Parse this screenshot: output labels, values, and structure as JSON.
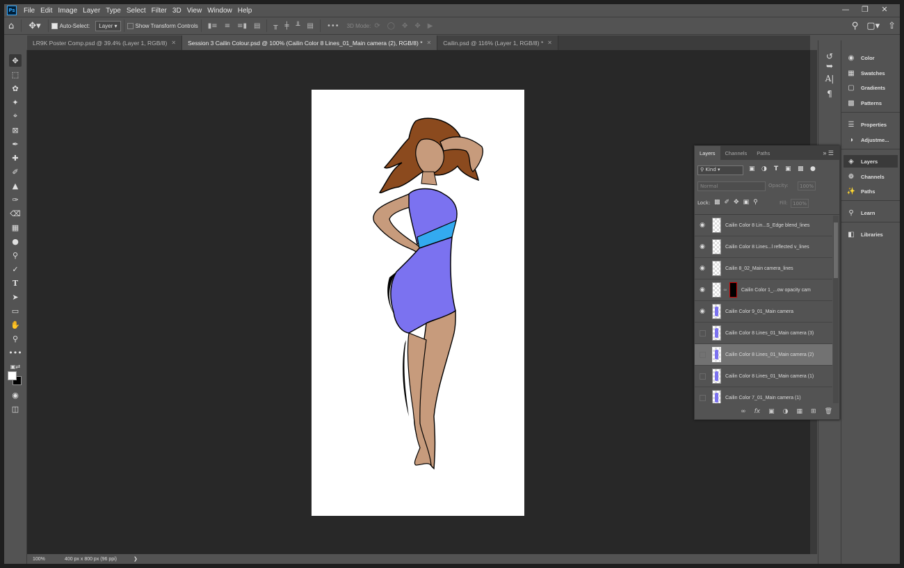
{
  "menubar": {
    "app_icon": "Ps",
    "items": [
      "File",
      "Edit",
      "Image",
      "Layer",
      "Type",
      "Select",
      "Filter",
      "3D",
      "View",
      "Window",
      "Help"
    ]
  },
  "options_bar": {
    "auto_select_label": "Auto-Select:",
    "auto_select_value": "Layer",
    "show_transform_label": "Show Transform Controls",
    "three_d_label": "3D Mode:",
    "auto_select_checked": true,
    "show_transform_checked": false
  },
  "tabs": [
    {
      "label": "LR9K Poster Comp.psd @ 39.4% (Layer 1, RGB/8)",
      "active": false
    },
    {
      "label": "Session 3 Cailin Colour.psd @ 100% (Cailin Color 8 Lines_01_Main camera (2), RGB/8) *",
      "active": true
    },
    {
      "label": "Cailin.psd @ 116% (Layer 1, RGB/8) *",
      "active": false
    }
  ],
  "status": {
    "zoom": "100%",
    "doc_info": "400 px x 800 px (96 ppi)"
  },
  "dock": {
    "items": [
      "Color",
      "Swatches",
      "Gradients",
      "Patterns",
      "Properties",
      "Adjustme...",
      "Layers",
      "Channels",
      "Paths",
      "Learn",
      "Libraries"
    ]
  },
  "layers_panel": {
    "tabs": [
      "Layers",
      "Channels",
      "Paths"
    ],
    "filter_label": "Kind",
    "blend_mode": "Normal",
    "opacity_label": "Opacity:",
    "opacity_value": "100%",
    "lock_label": "Lock:",
    "fill_label": "Fill:",
    "fill_value": "100%",
    "layers": [
      {
        "name": "Cailin Color 8 Lin...S_Edge blend_lines",
        "visible": true
      },
      {
        "name": "Cailin Color 8 Lines...l reflected v_lines",
        "visible": true
      },
      {
        "name": "Cailin 8_02_Main camera_lines",
        "visible": true
      },
      {
        "name": "Cailin Color 1_...ow opacity cam",
        "visible": true
      },
      {
        "name": "Cailin Color 9_01_Main camera",
        "visible": true
      },
      {
        "name": "Cailin Color 8 Lines_01_Main camera (3)",
        "visible": false
      },
      {
        "name": "Cailin Color 8 Lines_01_Main camera (2)",
        "visible": false
      },
      {
        "name": "Cailin Color 8 Lines_01_Main camera (1)",
        "visible": false
      },
      {
        "name": "Cailin Color 7_01_Main camera (1)",
        "visible": false
      }
    ]
  }
}
